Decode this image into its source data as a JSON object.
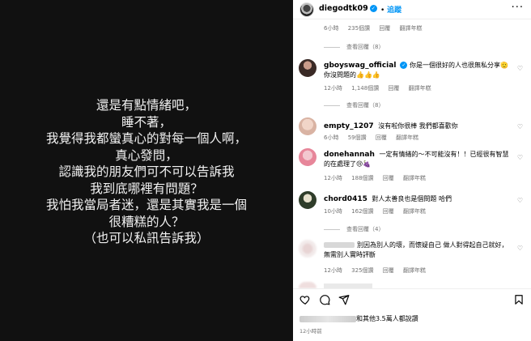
{
  "post": {
    "lines": [
      "還是有點情緒吧，",
      "睡不著，",
      "我覺得我都蠻真心的對每一個人啊，",
      "真心發問，",
      "認識我的朋友們可不可以告訴我",
      "我到底哪裡有問題？",
      "我怕我當局者迷，還是其實我是一個",
      "很糟糕的人？",
      "（也可以私訊告訴我）"
    ]
  },
  "header": {
    "username": "diegodtk09",
    "follow": "追蹤",
    "more": "···",
    "verified": "✓"
  },
  "top_meta": {
    "time": "6小時",
    "likes": "235個讚",
    "reply": "回覆",
    "translate": "翻譯年糕"
  },
  "view_replies_1": "查看回覆（8）",
  "comments": [
    {
      "username": "gboyswag_official",
      "text": "你是一個很好的人也很無私分享🫡 你沒問題的👍👍👍",
      "time": "12小時",
      "likes": "1,148個讚",
      "reply": "回覆",
      "translate": "翻譯年糕",
      "view_replies": "查看回覆（8）"
    },
    {
      "username": "empty_1207",
      "text": "沒有啦你很棒 我們都喜歡你",
      "time": "6小時",
      "likes": "59個讚",
      "reply": "回覆",
      "translate": "翻譯年糕"
    },
    {
      "username": "donehannah",
      "text": "一定有情緒的～不可能沒有！！已經很有智慧的在處理了😢🍇",
      "time": "12小時",
      "likes": "188個讚",
      "reply": "回覆",
      "translate": "翻譯年糕"
    },
    {
      "username": "chord0415",
      "text": "對人太善良也是個問題 哈們",
      "time": "10小時",
      "likes": "162個讚",
      "reply": "回覆",
      "translate": "翻譯年糕",
      "view_replies": "查看回覆（4）"
    },
    {
      "username": "",
      "text": "別因為別人的壞，而懷疑自己 做人對得起自己就好，無需別人實時評斷",
      "time": "12小時",
      "likes": "325個讚",
      "reply": "回覆",
      "translate": "翻譯年糕"
    }
  ],
  "likes_summary": "和其他3.5萬人都說讚",
  "post_time": "12小時前",
  "icons": [
    "heart-icon",
    "comment-icon",
    "share-icon",
    "bookmark-icon"
  ],
  "colors": {
    "accent": "#0095f6",
    "post_bg": "#111111"
  }
}
